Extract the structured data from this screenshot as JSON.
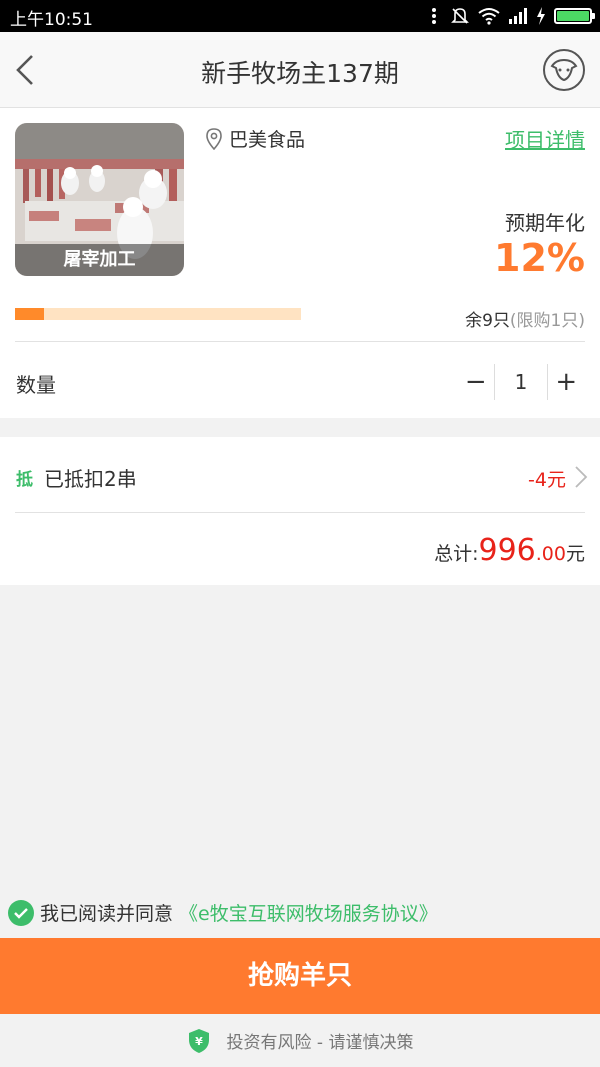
{
  "status_bar": {
    "time": "上午10:51"
  },
  "nav": {
    "title": "新手牧场主137期"
  },
  "product": {
    "image_caption": "屠宰加工",
    "location": "巴美食品",
    "detail_link": "项目详情",
    "yield_label": "预期年化",
    "yield_value": "12%",
    "sold_fraction": 0.1,
    "stock_text": "余9只",
    "limit_text": "(限购1只)"
  },
  "quantity": {
    "label": "数量",
    "value": "1",
    "minus": "−",
    "plus": "+"
  },
  "coupon": {
    "icon_text": "抵",
    "label": "已抵扣2串",
    "amount": "-4元"
  },
  "total": {
    "label": "总计:",
    "integer": "996",
    "decimal": ".00",
    "unit": "元"
  },
  "agreement": {
    "text": "我已阅读并同意",
    "link": "《e牧宝互联网牧场服务协议》"
  },
  "buy_button": {
    "label": "抢购羊只"
  },
  "risk": {
    "text": "投资有风险 - 请谨慎决策",
    "shield_symbol": "¥"
  },
  "colors": {
    "accent": "#ff7a2f",
    "green": "#3dbd6a",
    "price_red": "#e8231a"
  }
}
